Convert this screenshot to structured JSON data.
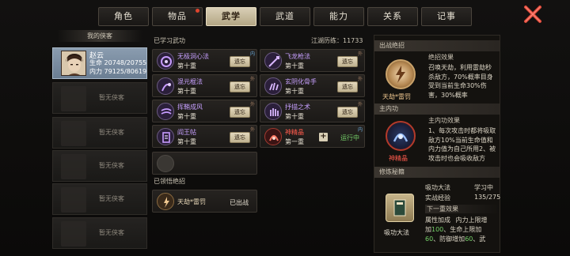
{
  "tabs": [
    {
      "label": "角色",
      "active": false,
      "badge": false
    },
    {
      "label": "物品",
      "active": false,
      "badge": true
    },
    {
      "label": "武学",
      "active": true,
      "badge": false
    },
    {
      "label": "武道",
      "active": false,
      "badge": false
    },
    {
      "label": "能力",
      "active": false,
      "badge": false
    },
    {
      "label": "关系",
      "active": false,
      "badge": false
    },
    {
      "label": "记事",
      "active": false,
      "badge": false
    }
  ],
  "left": {
    "header": "我的侠客",
    "hero": {
      "name": "赵云",
      "hp_label": "生命",
      "hp_value": "20748/20755",
      "mp_label": "内力",
      "mp_value": "79125/80619"
    },
    "empty_label": "暂无侠客"
  },
  "learned": {
    "title": "已学习武功",
    "fame_label": "江湖历练：",
    "fame_value": "11733",
    "skills": [
      {
        "name": "无极洞心法",
        "level": "第十重",
        "action": "遗忘",
        "tag": "内",
        "color": "purple"
      },
      {
        "name": "飞龙枪法",
        "level": "第十重",
        "action": "遗忘",
        "tag": "外",
        "color": "purple"
      },
      {
        "name": "混元棍法",
        "level": "第十重",
        "action": "遗忘",
        "tag": "外",
        "color": "purple"
      },
      {
        "name": "玄阴化骨手",
        "level": "第十重",
        "action": "遗忘",
        "tag": "外",
        "color": "purple"
      },
      {
        "name": "挥鞘成风",
        "level": "第十重",
        "action": "遗忘",
        "tag": "外",
        "color": "purple"
      },
      {
        "name": "抒描之术",
        "level": "第十重",
        "action": "遗忘",
        "tag": "外",
        "color": "purple"
      },
      {
        "name": "阎王帖",
        "level": "第十重",
        "action": "遗忘",
        "tag": "外",
        "color": "purple"
      },
      {
        "name": "神精晶",
        "level": "第一重",
        "action": "运行中",
        "tag": "内",
        "color": "red"
      }
    ]
  },
  "ultimate": {
    "title": "已领悟绝招",
    "name": "天劫*雷罚",
    "status": "已出战"
  },
  "right": {
    "sec1_title": "出战绝招",
    "sec1_caption": "天劫*雷罚",
    "sec1_sub": "绝招效果",
    "sec1_desc": "召唤天劫，利用雷劫秒杀敌方，70%概率目身受到当前生命30%伤害，30%概率",
    "sec2_title": "主内功",
    "sec2_caption": "神精晶",
    "sec2_sub": "主内功效果",
    "sec2_desc": "1、每次攻击时都将吸取敌方10%当前生命值和内力值为自己所用2、被攻击时也会吸收敌方10%当前生命值",
    "sec3_title": "修炼秘籍",
    "sec3_caption": "吸功大法",
    "book_name": "吸功大法",
    "book_status": "学习中",
    "exp_label": "实战经验",
    "exp_value": "135/275",
    "next_label": "下一重效果",
    "bonus_label": "属性加成",
    "bonus_l1a": "内力上限增",
    "bonus_l2a": "加",
    "bonus_l2b": "100",
    "bonus_l2c": "、生命上限加",
    "bonus_l3a": "60",
    "bonus_l3b": "、防御增加",
    "bonus_l3c": "60",
    "bonus_l3d": "、武"
  },
  "colors": {
    "accent": "#d9cfb6",
    "purple": "#c7a0ff",
    "red": "#ff5a4c",
    "green": "#76d16a",
    "close": "#e04b3b"
  },
  "icons": {
    "close": "close-icon"
  }
}
